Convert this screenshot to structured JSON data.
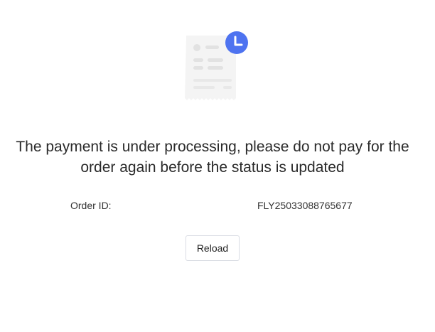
{
  "status": {
    "message": "The payment is under processing, please do not pay for the order again before the status is updated",
    "illustration_icon": "receipt-clock-icon"
  },
  "order": {
    "label": "Order ID:",
    "value": "FLY25033088765677"
  },
  "actions": {
    "reload_label": "Reload"
  },
  "colors": {
    "accent": "#4e73f0",
    "text": "#2a2a2a",
    "receipt": "#f2f2f2"
  }
}
